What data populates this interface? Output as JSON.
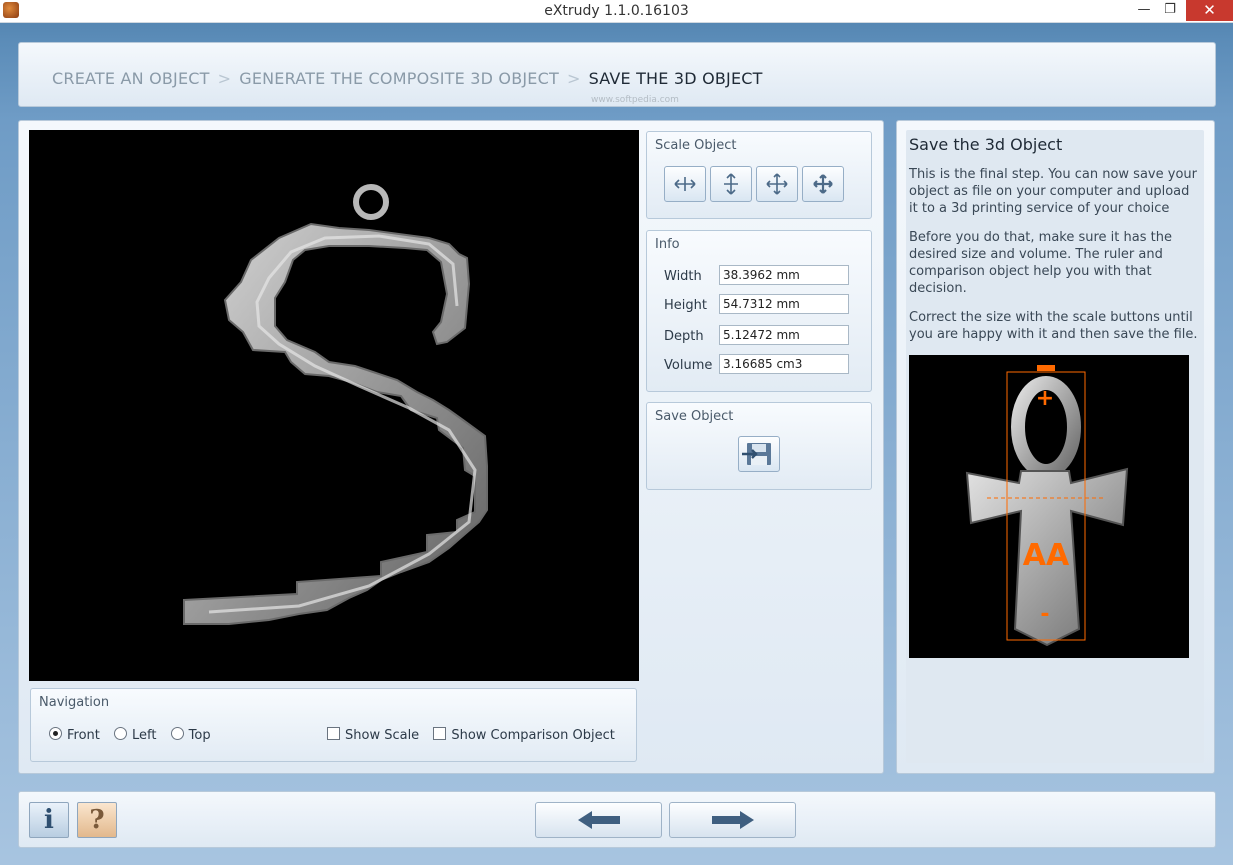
{
  "window": {
    "title": "eXtrudy 1.1.0.16103",
    "minimize_glyph": "—",
    "maximize_glyph": "❐",
    "close_glyph": "✕"
  },
  "breadcrumb": {
    "steps": [
      "CREATE AN OBJECT",
      "GENERATE THE COMPOSITE 3D OBJECT",
      "SAVE THE 3D OBJECT"
    ],
    "separator": ">",
    "active_index": 2,
    "watermark": "www.softpedia.com"
  },
  "navigation": {
    "title": "Navigation",
    "views": [
      {
        "label": "Front",
        "selected": true
      },
      {
        "label": "Left",
        "selected": false
      },
      {
        "label": "Top",
        "selected": false
      }
    ],
    "show_scale": {
      "label": "Show Scale",
      "checked": false
    },
    "show_comparison": {
      "label": "Show Comparison Object",
      "checked": false
    }
  },
  "scale": {
    "title": "Scale Object",
    "buttons": [
      "scale-x-icon",
      "scale-y-icon",
      "scale-xy-icon",
      "scale-all-icon"
    ]
  },
  "info": {
    "title": "Info",
    "rows": [
      {
        "label": "Width",
        "value": "38.3962 mm"
      },
      {
        "label": "Height",
        "value": "54.7312 mm"
      },
      {
        "label": "Depth",
        "value": "5.12472 mm"
      },
      {
        "label": "Volume",
        "value": "3.16685 cm3"
      }
    ]
  },
  "save": {
    "title": "Save Object",
    "icon": "save-disk-icon"
  },
  "help": {
    "title": "Save the 3d Object",
    "p1": "This is the final step. You can now save your object as file on your computer and upload it to a 3d printing service of your choice",
    "p2": "Before you do that, make sure it has the desired size and volume. The ruler and comparison object help you with that decision.",
    "p3": "Correct the size with the scale buttons until you are happy with it and then save the file.",
    "preview_label": "AA",
    "preview_plus": "+",
    "preview_minus": "-",
    "accent": "#ff6a00"
  },
  "footer": {
    "info_label": "i",
    "help_label": "?",
    "back_icon": "arrow-left-icon",
    "next_icon": "arrow-right-icon"
  }
}
